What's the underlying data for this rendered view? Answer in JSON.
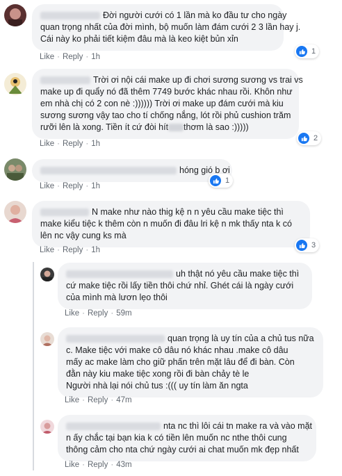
{
  "comments": [
    {
      "lines": [
        "Đời người cưới có 1 lần mà ko đầu tư cho ngày",
        "quan trọng nhất của đời mình, bộ muốn làm đám cưới 2 3 lần hay j.",
        "Cái này ko phải tiết kiệm đâu mà là keo kiệt bủn xỉn"
      ],
      "like": "Like",
      "reply": "Reply",
      "time": "1h",
      "reactions": "1"
    },
    {
      "lines": [
        "Trời ơi nội cái make up đi chơi sương sương vs trai vs",
        "make up đi quẩy nó đã thêm 7749 bước khác nhau rồi. Khôn như",
        "em nhà chị có 2 con nè :)))))) Trời ơi make up đám cưới mà kiu",
        "sương sương vậy tao cho tí chống nắng, lót rồi phủ cushion trăm",
        "rưỡi lên là xong. Tiền ít cứ đòi hít",
        "thơm là sao :)))))"
      ],
      "like": "Like",
      "reply": "Reply",
      "time": "1h",
      "reactions": "2"
    },
    {
      "lines": [
        "hóng gió b ơi"
      ],
      "like": "Like",
      "reply": "Reply",
      "time": "1h",
      "reactions": "1"
    },
    {
      "lines": [
        "N make như nào thig kệ n n yêu cầu make tiệc thì",
        "make kiểu tiệc k thêm còn n muốn đi đâu lri kệ n mk thấy nta k có",
        "lên nc vậy cung ks mà"
      ],
      "like": "Like",
      "reply": "Reply",
      "time": "1h",
      "reactions": "3"
    },
    {
      "lines": [
        "uh thật nó yêu cầu make tiệc thì",
        "cứ make tiệc rồi lấy tiền thôi chứ nhỉ. Ghét cái là ngày cưới",
        "của mình mà lươn lẹo thôi"
      ],
      "like": "Like",
      "reply": "Reply",
      "time": "59m"
    },
    {
      "lines": [
        "quan trọng là uy tín của a chủ tus nữa",
        "c. Make tiệc với make cô dâu nó khác nhau .make cô dâu",
        "mấy ac make làm cho giữ phấn trên mặt lâu để đi bàn. Còn",
        "đằn này kiu make tiệc xong rồi đi bàn chảy tè le",
        "Người nhà lại nói chủ tus :((( uy tín làm ăn ngta"
      ],
      "like": "Like",
      "reply": "Reply",
      "time": "47m"
    },
    {
      "lines": [
        "nta nc thì lôi cái tn make ra và vào mặt",
        "n ấy chắc tại bạn kia k có tiền lên muốn nc nthe thôi cung",
        "thông cảm cho nta chứ ngày cưới ai chat muốn mk đẹp nhất"
      ],
      "like": "Like",
      "reply": "Reply",
      "time": "43m"
    }
  ],
  "colors": {
    "like_blue": "#1877f2",
    "bubble_bg": "#f2f3f5",
    "action_gray": "#606770"
  }
}
